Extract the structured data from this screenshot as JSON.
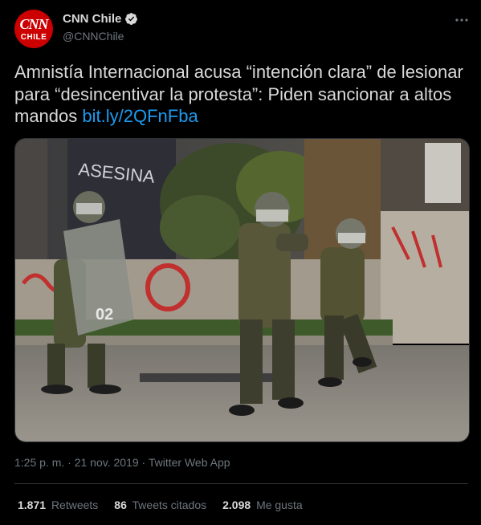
{
  "author": {
    "display_name": "CNN Chile",
    "handle": "@CNNChile",
    "avatar_top": "CNN",
    "avatar_bottom": "CHILE",
    "verified": true
  },
  "tweet": {
    "text": "Amnistía Internacional acusa “intención clara” de lesionar para “desincentivar la protesta”: Piden sancionar a altos mandos",
    "link": "bit.ly/2QFnFba"
  },
  "media": {
    "graffiti_1": "ASESINA",
    "shield_number": "02"
  },
  "meta": {
    "time": "1:25 p. m.",
    "separator": "·",
    "date": "21 nov. 2019",
    "source": "Twitter Web App"
  },
  "stats": [
    {
      "value": "1.871",
      "label": "Retweets"
    },
    {
      "value": "86",
      "label": "Tweets citados"
    },
    {
      "value": "2.098",
      "label": "Me gusta"
    }
  ],
  "colors": {
    "background": "#000000",
    "text": "#d9d9d9",
    "secondary": "#6e767d",
    "link": "#1d9bf0",
    "avatar": "#cc0000",
    "divider": "#2f3336"
  },
  "icons": {
    "verified": "verified-badge-icon",
    "more": "more-options-icon"
  }
}
